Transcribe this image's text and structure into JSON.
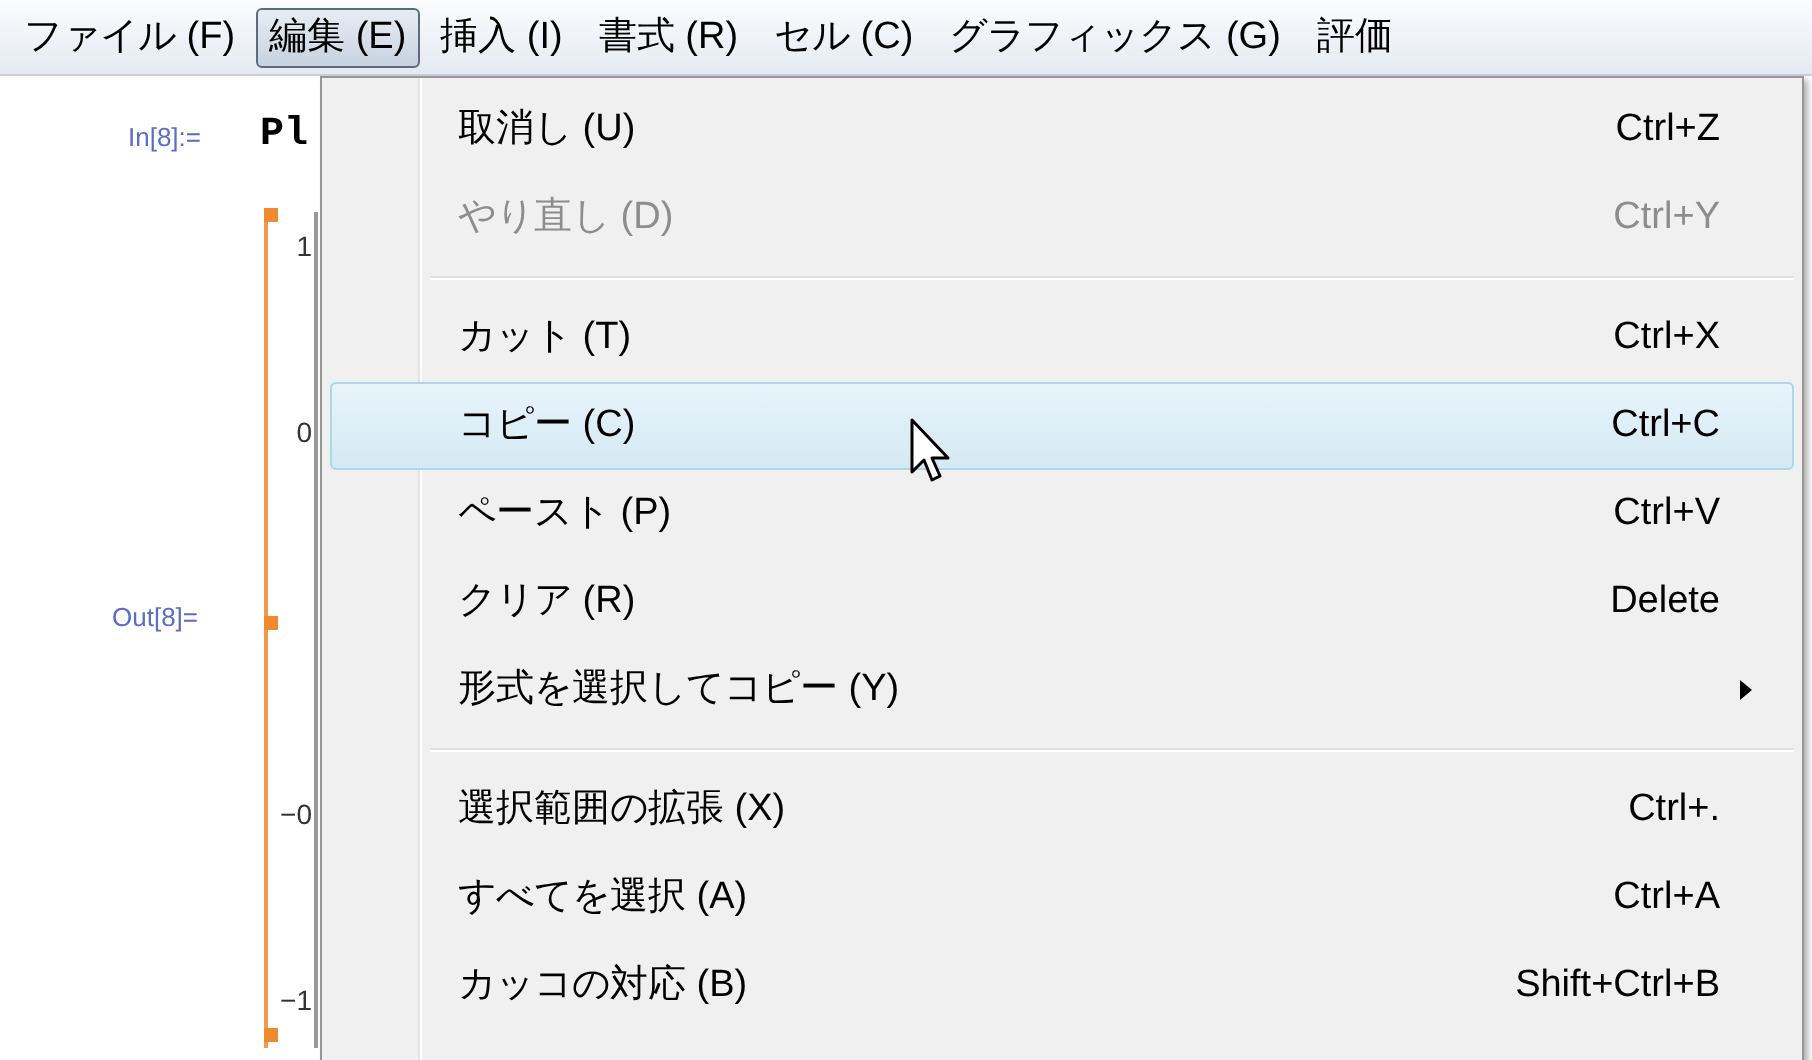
{
  "menubar": [
    {
      "label": "ファイル (F)",
      "selected": false
    },
    {
      "label": "編集 (E)",
      "selected": true
    },
    {
      "label": "挿入 (I)",
      "selected": false
    },
    {
      "label": "書式 (R)",
      "selected": false
    },
    {
      "label": "セル (C)",
      "selected": false
    },
    {
      "label": "グラフィックス (G)",
      "selected": false
    },
    {
      "label": "評価",
      "selected": false
    }
  ],
  "notebook": {
    "input_label": "In[8]:=",
    "input_code": "Pl",
    "output_label": "Out[8]=",
    "plot_ticks": [
      "1",
      "0",
      "−0",
      "−1"
    ]
  },
  "menu": [
    {
      "kind": "item",
      "label": "取消し (U)",
      "shortcut": "Ctrl+Z",
      "disabled": false,
      "selected": false,
      "submenu": false
    },
    {
      "kind": "item",
      "label": "やり直し (D)",
      "shortcut": "Ctrl+Y",
      "disabled": true,
      "selected": false,
      "submenu": false
    },
    {
      "kind": "separator"
    },
    {
      "kind": "item",
      "label": "カット (T)",
      "shortcut": "Ctrl+X",
      "disabled": false,
      "selected": false,
      "submenu": false
    },
    {
      "kind": "item",
      "label": "コピー (C)",
      "shortcut": "Ctrl+C",
      "disabled": false,
      "selected": true,
      "submenu": false
    },
    {
      "kind": "item",
      "label": "ペースト (P)",
      "shortcut": "Ctrl+V",
      "disabled": false,
      "selected": false,
      "submenu": false
    },
    {
      "kind": "item",
      "label": "クリア (R)",
      "shortcut": "Delete",
      "disabled": false,
      "selected": false,
      "submenu": false
    },
    {
      "kind": "item",
      "label": "形式を選択してコピー (Y)",
      "disabled": false,
      "selected": false,
      "submenu": true
    },
    {
      "kind": "separator"
    },
    {
      "kind": "item",
      "label": "選択範囲の拡張 (X)",
      "shortcut": "Ctrl+.",
      "disabled": false,
      "selected": false,
      "submenu": false
    },
    {
      "kind": "item",
      "label": "すべてを選択 (A)",
      "shortcut": "Ctrl+A",
      "disabled": false,
      "selected": false,
      "submenu": false
    },
    {
      "kind": "item",
      "label": "カッコの対応 (B)",
      "shortcut": "Shift+Ctrl+B",
      "disabled": false,
      "selected": false,
      "submenu": false
    }
  ]
}
